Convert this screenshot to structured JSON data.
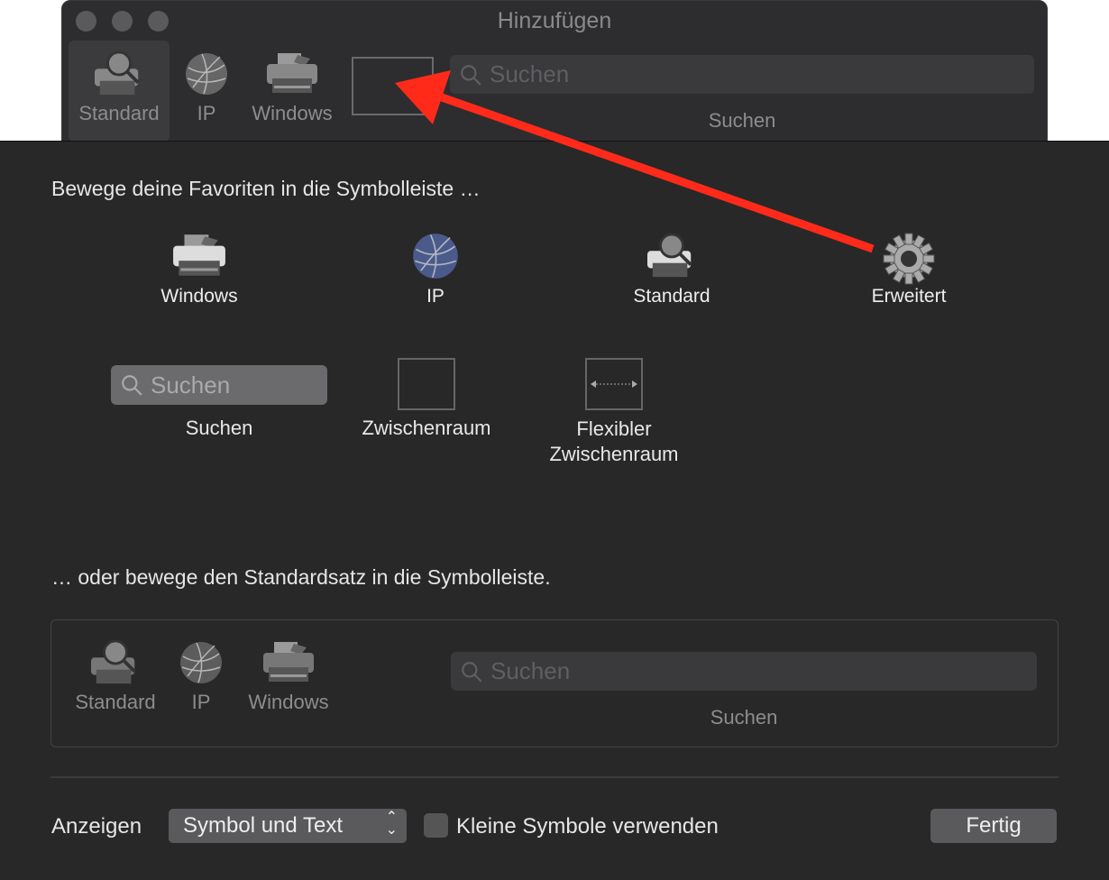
{
  "window": {
    "title": "Hinzufügen",
    "toolbar": [
      {
        "label": "Standard",
        "icon": "printer-magnifier-icon",
        "selected": true
      },
      {
        "label": "IP",
        "icon": "globe-icon"
      },
      {
        "label": "Windows",
        "icon": "printer-icon"
      }
    ],
    "search_placeholder": "Suchen",
    "search_label": "Suchen"
  },
  "sheet": {
    "favorites_heading": "Bewege deine Favoriten in die Symbolleiste …",
    "favorites": [
      {
        "label": "Windows",
        "icon": "printer-icon"
      },
      {
        "label": "IP",
        "icon": "globe-icon"
      },
      {
        "label": "Standard",
        "icon": "printer-magnifier-icon"
      },
      {
        "label": "Erweitert",
        "icon": "gear-icon"
      }
    ],
    "search_placeholder": "Suchen",
    "search_label": "Suchen",
    "space_label": "Zwischenraum",
    "flex_space_label_1": "Flexibler",
    "flex_space_label_2": "Zwischenraum",
    "default_heading": "… oder bewege den Standardsatz in die Symbolleiste.",
    "default_set": [
      {
        "label": "Standard"
      },
      {
        "label": "IP"
      },
      {
        "label": "Windows"
      }
    ],
    "default_search_placeholder": "Suchen",
    "default_search_label": "Suchen",
    "show_label": "Anzeigen",
    "show_value": "Symbol und Text",
    "small_icons_label": "Kleine Symbole verwenden",
    "small_icons_checked": false,
    "done_label": "Fertig"
  },
  "annotation": {
    "arrow_color": "#ff2a1a"
  }
}
